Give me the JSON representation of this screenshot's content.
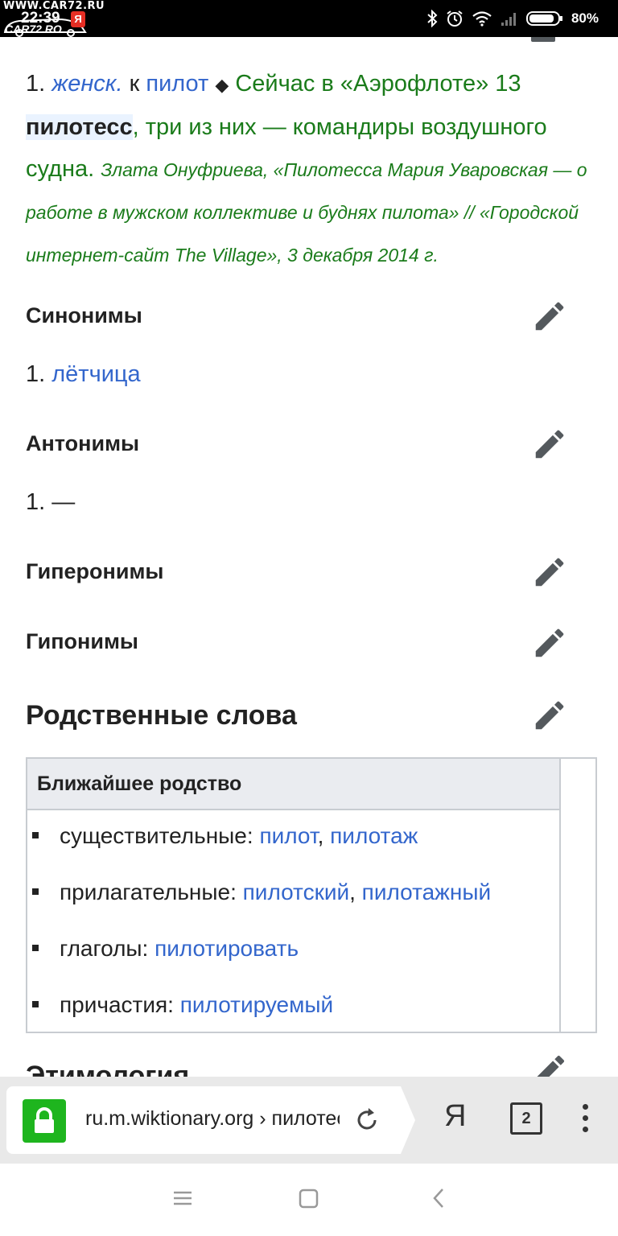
{
  "status_bar": {
    "watermark_top": "WWW.CAR72.RU",
    "watermark_bottom": "CAR72.RO",
    "time": "22:39",
    "y_badge": "Я",
    "battery_percent": "80%"
  },
  "definition": {
    "number": "1.",
    "label": "женск.",
    "k": "к",
    "base_word": "пилот",
    "example_part1": "Сейчас в «Аэрофлоте» 13",
    "example_bold": "пилотесс",
    "example_part2": ", три из них — командиры воздушного судна.",
    "citation": "Злата Онуфриева, «Пилотесса Мария Уваровская — о работе в мужском коллективе и буднях пилота» // «Городской интернет-сайт The Village», 3 декабря 2014 г."
  },
  "sections": {
    "synonyms": {
      "title": "Синонимы",
      "item_num": "1.",
      "item_link": "лётчица"
    },
    "antonyms": {
      "title": "Антонимы",
      "item_num": "1.",
      "item_text": "—"
    },
    "hypernyms": {
      "title": "Гиперонимы"
    },
    "hyponyms": {
      "title": "Гипонимы"
    },
    "related": {
      "title": "Родственные слова"
    },
    "etymology": {
      "title": "Этимология"
    }
  },
  "related_table": {
    "header": "Ближайшее родство",
    "rows": [
      {
        "label": "существительные:",
        "links": [
          "пилот",
          "пилотаж"
        ]
      },
      {
        "label": "прилагательные:",
        "links": [
          "пилотский",
          "пилотажный"
        ]
      },
      {
        "label": "глаголы:",
        "links": [
          "пилотировать"
        ]
      },
      {
        "label": "причастия:",
        "links": [
          "пилотируемый"
        ]
      }
    ],
    "separator": ","
  },
  "browser": {
    "url": "ru.m.wiktionary.org › пилотесса",
    "ya_label": "Я",
    "tabs_count": "2"
  },
  "icons": {
    "edit": "pencil-icon",
    "lock": "lock-icon",
    "reload": "reload-icon",
    "menu": "kebab-menu-icon"
  },
  "colors": {
    "link": "#3366cc",
    "example_green": "#1a7b1a",
    "lock_green": "#1eb51e",
    "table_header_bg": "#eaecf0"
  }
}
